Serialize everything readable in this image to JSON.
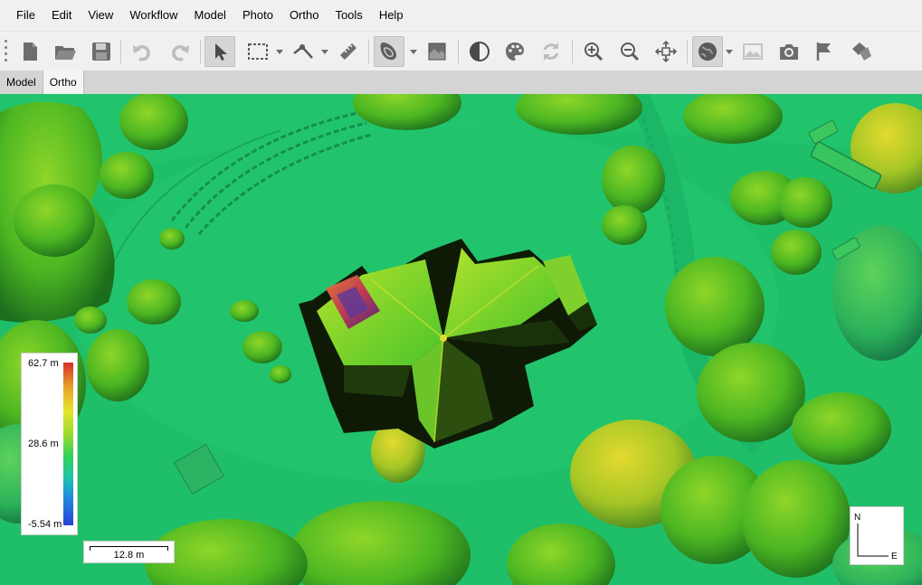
{
  "menu": [
    {
      "label": "File"
    },
    {
      "label": "Edit"
    },
    {
      "label": "View"
    },
    {
      "label": "Workflow"
    },
    {
      "label": "Model"
    },
    {
      "label": "Photo"
    },
    {
      "label": "Ortho"
    },
    {
      "label": "Tools"
    },
    {
      "label": "Help"
    }
  ],
  "toolbar": {
    "buttons": [
      {
        "name": "new-document",
        "icon": "new-document-icon"
      },
      {
        "name": "open",
        "icon": "folder-open-icon"
      },
      {
        "name": "save",
        "icon": "floppy-disk-icon"
      },
      {
        "name": "undo",
        "icon": "undo-icon"
      },
      {
        "name": "redo",
        "icon": "redo-icon"
      },
      {
        "name": "navigation",
        "icon": "pointer-arrow-icon"
      },
      {
        "name": "rectangle-selection",
        "icon": "rectangle-select-icon"
      },
      {
        "name": "draw-polyline",
        "icon": "polyline-icon"
      },
      {
        "name": "ruler",
        "icon": "ruler-icon"
      },
      {
        "name": "dem-view",
        "icon": "dem-contour-icon"
      },
      {
        "name": "orthomosaic-view",
        "icon": "orthomosaic-icon"
      },
      {
        "name": "hillshading",
        "icon": "half-circle-contrast-icon"
      },
      {
        "name": "palette",
        "icon": "palette-icon"
      },
      {
        "name": "refresh",
        "icon": "refresh-icon"
      },
      {
        "name": "zoom-in",
        "icon": "zoom-in-icon"
      },
      {
        "name": "zoom-out",
        "icon": "zoom-out-icon"
      },
      {
        "name": "reset-view",
        "icon": "reset-view-arrows-icon"
      },
      {
        "name": "basemap",
        "icon": "globe-icon"
      },
      {
        "name": "show-images",
        "icon": "image-icon"
      },
      {
        "name": "capture-view",
        "icon": "camera-icon"
      },
      {
        "name": "markers",
        "icon": "flag-icon"
      },
      {
        "name": "shapes",
        "icon": "shapes-icon"
      }
    ]
  },
  "tabs": [
    {
      "label": "Model",
      "active": false
    },
    {
      "label": "Ortho",
      "active": true
    }
  ],
  "legend": {
    "max": "62.7 m",
    "mid": "28.6 m",
    "min": "-5.54 m"
  },
  "scale_bar": {
    "label": "12.8 m"
  },
  "compass": {
    "north": "N",
    "east": "E"
  },
  "colors": {
    "ui_background": "#f0f0f0",
    "tab_bar": "#d4d4d4",
    "dem_ground": "#1fbf6a",
    "dem_high": "#d7302b",
    "dem_low": "#2a3fd6"
  }
}
